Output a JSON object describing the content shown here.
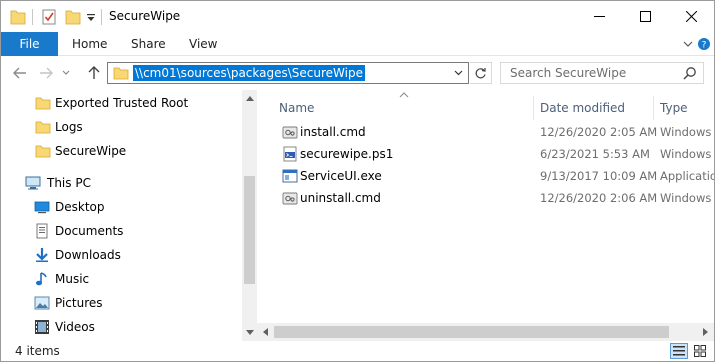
{
  "window": {
    "title": "SecureWipe",
    "controls": {
      "minimize": "—",
      "maximize": "☐",
      "close": "✕"
    }
  },
  "ribbon": {
    "file_tab": "File",
    "tabs": [
      "Home",
      "Share",
      "View"
    ]
  },
  "address": {
    "path": "\\\\cm01\\sources\\packages\\SecureWipe",
    "search_placeholder": "Search SecureWipe"
  },
  "nav": {
    "items": [
      {
        "label": "Exported Trusted Root",
        "icon": "folder-icon"
      },
      {
        "label": "Logs",
        "icon": "folder-icon"
      },
      {
        "label": "SecureWipe",
        "icon": "folder-icon"
      },
      {
        "label": "This PC",
        "icon": "pc-icon"
      },
      {
        "label": "Desktop",
        "icon": "desktop-icon"
      },
      {
        "label": "Documents",
        "icon": "documents-icon"
      },
      {
        "label": "Downloads",
        "icon": "downloads-icon"
      },
      {
        "label": "Music",
        "icon": "music-icon"
      },
      {
        "label": "Pictures",
        "icon": "pictures-icon"
      },
      {
        "label": "Videos",
        "icon": "videos-icon"
      }
    ]
  },
  "files": {
    "columns": [
      "Name",
      "Date modified",
      "Type"
    ],
    "rows": [
      {
        "name": "install.cmd",
        "date": "12/26/2020 2:05 AM",
        "type": "Windows C",
        "icon": "cmd-file-icon"
      },
      {
        "name": "securewipe.ps1",
        "date": "6/23/2021 5:53 AM",
        "type": "Windows P",
        "icon": "powershell-file-icon"
      },
      {
        "name": "ServiceUI.exe",
        "date": "9/13/2017 10:09 AM",
        "type": "Application",
        "icon": "exe-file-icon"
      },
      {
        "name": "uninstall.cmd",
        "date": "12/26/2020 2:06 AM",
        "type": "Windows C",
        "icon": "cmd-file-icon"
      }
    ]
  },
  "status": {
    "count": "4 items"
  },
  "colors": {
    "accent": "#1979ca",
    "selection": "#0078d7",
    "folder": "#f8d775"
  }
}
